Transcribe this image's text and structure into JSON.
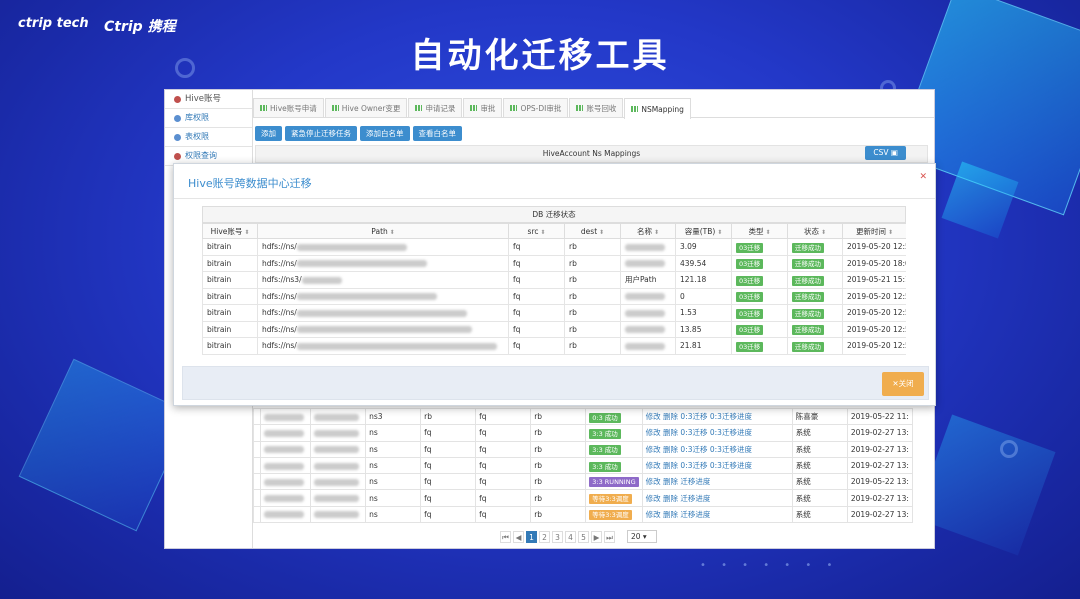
{
  "slide": {
    "title": "自动化迁移工具",
    "logo_left": "ctrip tech",
    "logo_right": "Ctrip 携程"
  },
  "sidebar": {
    "items": [
      {
        "label": "Hive账号"
      },
      {
        "label": "库权限"
      },
      {
        "label": "表权限"
      },
      {
        "label": "权限查询"
      }
    ]
  },
  "tabs": [
    {
      "label": "Hive账号申请"
    },
    {
      "label": "Hive Owner变更"
    },
    {
      "label": "申请记录"
    },
    {
      "label": "审批"
    },
    {
      "label": "OPS-DI审批"
    },
    {
      "label": "账号回收"
    },
    {
      "label": "NSMapping"
    }
  ],
  "toolbar": {
    "add": "添加",
    "stop": "紧急停止迁移任务",
    "add_whitelist": "添加白名单",
    "view_whitelist": "查看白名单",
    "table_title": "HiveAccount Ns Mappings",
    "csv": "CSV"
  },
  "bg_table": {
    "rows": [
      {
        "ns": "ns3",
        "src": "rb",
        "dest": "fq",
        "d2": "rb",
        "status": "0:3 成功",
        "status_color": "green",
        "actions": "修改 删除 0:3迁移 0:3迁移进度",
        "owner": "陈喜豪",
        "time": "2019-05-22 11:"
      },
      {
        "ns": "ns",
        "src": "fq",
        "dest": "fq",
        "d2": "rb",
        "status": "3:3 成功",
        "status_color": "green",
        "actions": "修改 删除 0:3迁移 0:3迁移进度",
        "owner": "系统",
        "time": "2019-02-27 13:"
      },
      {
        "ns": "ns",
        "src": "fq",
        "dest": "fq",
        "d2": "rb",
        "status": "3:3 成功",
        "status_color": "green",
        "actions": "修改 删除 0:3迁移 0:3迁移进度",
        "owner": "系统",
        "time": "2019-02-27 13:"
      },
      {
        "ns": "ns",
        "src": "fq",
        "dest": "fq",
        "d2": "rb",
        "status": "3:3 成功",
        "status_color": "green",
        "actions": "修改 删除 0:3迁移 0:3迁移进度",
        "owner": "系统",
        "time": "2019-02-27 13:"
      },
      {
        "ns": "ns",
        "src": "fq",
        "dest": "fq",
        "d2": "rb",
        "status": "3:3 RUNNING",
        "status_color": "purple",
        "actions": "修改 删除 迁移进度",
        "owner": "系统",
        "time": "2019-05-22 13:"
      },
      {
        "ns": "ns",
        "src": "fq",
        "dest": "fq",
        "d2": "rb",
        "status": "等待3:3调度",
        "status_color": "orange",
        "actions": "修改 删除 迁移进度",
        "owner": "系统",
        "time": "2019-02-27 13:"
      },
      {
        "ns": "ns",
        "src": "fq",
        "dest": "fq",
        "d2": "rb",
        "status": "等待3:3调度",
        "status_color": "orange",
        "actions": "修改 删除 迁移进度",
        "owner": "系统",
        "time": "2019-02-27 13:"
      }
    ]
  },
  "pager": {
    "pages": [
      "1",
      "2",
      "3",
      "4",
      "5"
    ],
    "page_size": "20"
  },
  "modal": {
    "title": "Hive账号跨数据中心迁移",
    "caption": "DB 迁移状态",
    "close": "关闭",
    "headers": [
      "Hive账号",
      "Path",
      "src",
      "dest",
      "名称",
      "容量(TB)",
      "类型",
      "状态",
      "更新时间"
    ],
    "rows": [
      {
        "account": "bitrain",
        "path": "hdfs://ns/",
        "src": "fq",
        "dest": "rb",
        "name": "",
        "size": "3.09",
        "type": "03迁移",
        "state": "迁移成功",
        "time": "2019-05-20 12:58"
      },
      {
        "account": "bitrain",
        "path": "hdfs://ns/",
        "src": "fq",
        "dest": "rb",
        "name": "",
        "size": "439.54",
        "type": "03迁移",
        "state": "迁移成功",
        "time": "2019-05-20 18:06"
      },
      {
        "account": "bitrain",
        "path": "hdfs://ns3/",
        "src": "fq",
        "dest": "rb",
        "name": "用户Path",
        "size": "121.18",
        "type": "03迁移",
        "state": "迁移成功",
        "time": "2019-05-21 15:16"
      },
      {
        "account": "bitrain",
        "path": "hdfs://ns/",
        "src": "fq",
        "dest": "rb",
        "name": "",
        "size": "0",
        "type": "03迁移",
        "state": "迁移成功",
        "time": "2019-05-20 12:58"
      },
      {
        "account": "bitrain",
        "path": "hdfs://ns/",
        "src": "fq",
        "dest": "rb",
        "name": "",
        "size": "1.53",
        "type": "03迁移",
        "state": "迁移成功",
        "time": "2019-05-20 12:58"
      },
      {
        "account": "bitrain",
        "path": "hdfs://ns/",
        "src": "fq",
        "dest": "rb",
        "name": "",
        "size": "13.85",
        "type": "03迁移",
        "state": "迁移成功",
        "time": "2019-05-20 12:58"
      },
      {
        "account": "bitrain",
        "path": "hdfs://ns/",
        "src": "fq",
        "dest": "rb",
        "name": "",
        "size": "21.81",
        "type": "03迁移",
        "state": "迁移成功",
        "time": "2019-05-20 12:58"
      }
    ]
  }
}
